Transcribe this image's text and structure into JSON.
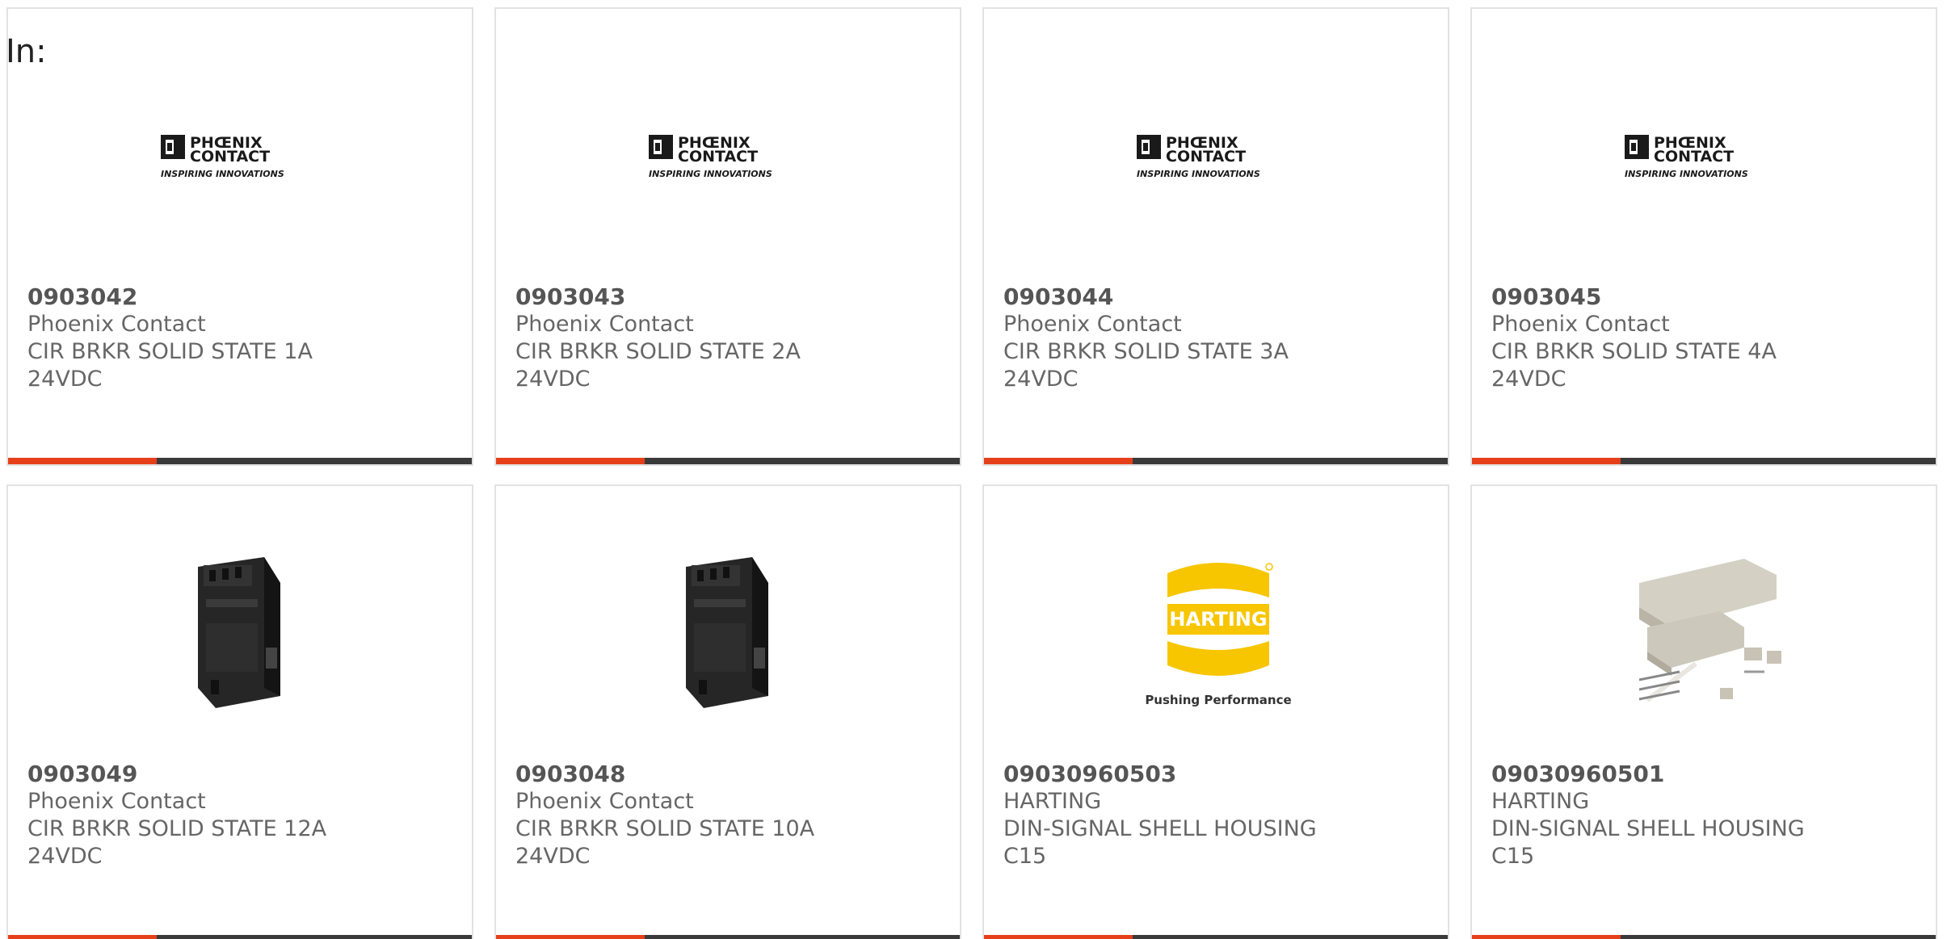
{
  "header": {
    "label": "In:"
  },
  "accent_color": "#e5401a",
  "bar_color": "#3a3a3a",
  "products": [
    {
      "part_number": "0903042",
      "manufacturer": "Phoenix Contact",
      "desc_line1": "CIR BRKR SOLID STATE 1A",
      "desc_line2": "24VDC",
      "image": "phoenix-contact-logo"
    },
    {
      "part_number": "0903043",
      "manufacturer": "Phoenix Contact",
      "desc_line1": "CIR BRKR SOLID STATE 2A",
      "desc_line2": "24VDC",
      "image": "phoenix-contact-logo"
    },
    {
      "part_number": "0903044",
      "manufacturer": "Phoenix Contact",
      "desc_line1": "CIR BRKR SOLID STATE 3A",
      "desc_line2": "24VDC",
      "image": "phoenix-contact-logo"
    },
    {
      "part_number": "0903045",
      "manufacturer": "Phoenix Contact",
      "desc_line1": "CIR BRKR SOLID STATE 4A",
      "desc_line2": "24VDC",
      "image": "phoenix-contact-logo"
    },
    {
      "part_number": "0903049",
      "manufacturer": "Phoenix Contact",
      "desc_line1": "CIR BRKR SOLID STATE 12A",
      "desc_line2": "24VDC",
      "image": "circuit-breaker-photo"
    },
    {
      "part_number": "0903048",
      "manufacturer": "Phoenix Contact",
      "desc_line1": "CIR BRKR SOLID STATE 10A",
      "desc_line2": "24VDC",
      "image": "circuit-breaker-photo"
    },
    {
      "part_number": "09030960503",
      "manufacturer": "HARTING",
      "desc_line1": "DIN-SIGNAL SHELL HOUSING",
      "desc_line2": "C15",
      "image": "harting-logo"
    },
    {
      "part_number": "09030960501",
      "manufacturer": "HARTING",
      "desc_line1": "DIN-SIGNAL SHELL HOUSING",
      "desc_line2": "C15",
      "image": "shell-housing-photo"
    }
  ],
  "logos": {
    "phoenix_line1": "PHŒNIX",
    "phoenix_line2": "CONTACT",
    "phoenix_tagline": "INSPIRING INNOVATIONS",
    "harting_name": "HARTING",
    "harting_tagline": "Pushing Performance"
  }
}
